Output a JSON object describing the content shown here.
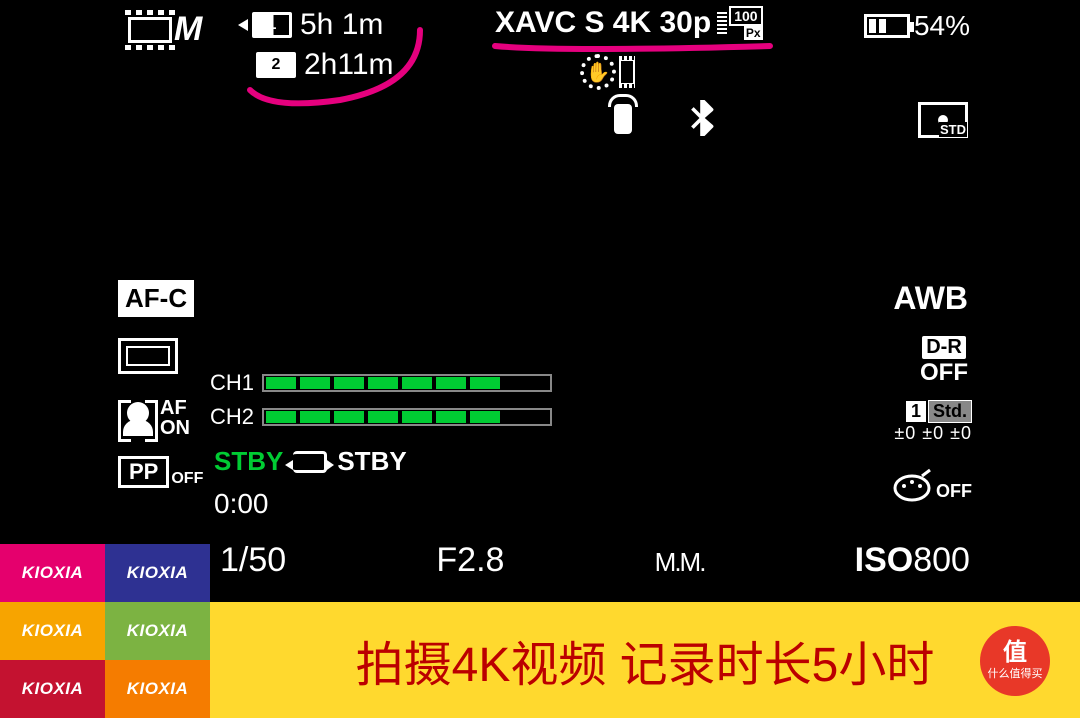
{
  "top": {
    "mode": "M",
    "slots": [
      {
        "num": "1",
        "time": "5h 1m"
      },
      {
        "num": "2",
        "time": "2h11m"
      }
    ],
    "format": "XAVC S 4K 30p",
    "bitrate": "100",
    "px": "Px",
    "battery": "54%"
  },
  "row2": {
    "bluetooth": "✱",
    "metering": "STD"
  },
  "left": {
    "focus_mode": "AF-C",
    "face_af_top": "AF",
    "face_af_bot": "ON",
    "pp": "PP",
    "pp_state": "OFF"
  },
  "audio": {
    "ch1_label": "CH1",
    "ch2_label": "CH2",
    "segments": 7,
    "stby1": "STBY",
    "stby2": "STBY"
  },
  "timecode": "0:00",
  "exposure": {
    "shutter": "1/50",
    "aperture": "F2.8",
    "mm": "M.M.",
    "iso_label": "ISO",
    "iso_value": "800"
  },
  "right": {
    "wb": "AWB",
    "dro": "D-R",
    "dro_state": "OFF",
    "creative_1": "1",
    "creative_std": "Std.",
    "creative_vals": "±0 ±0 ±0",
    "effect_off": "OFF"
  },
  "banner": {
    "kioxia": "KIOXIA",
    "caption": "拍摄4K视频 记录时长5小时",
    "smzdm_char": "值",
    "smzdm_txt": "什么值得买"
  }
}
